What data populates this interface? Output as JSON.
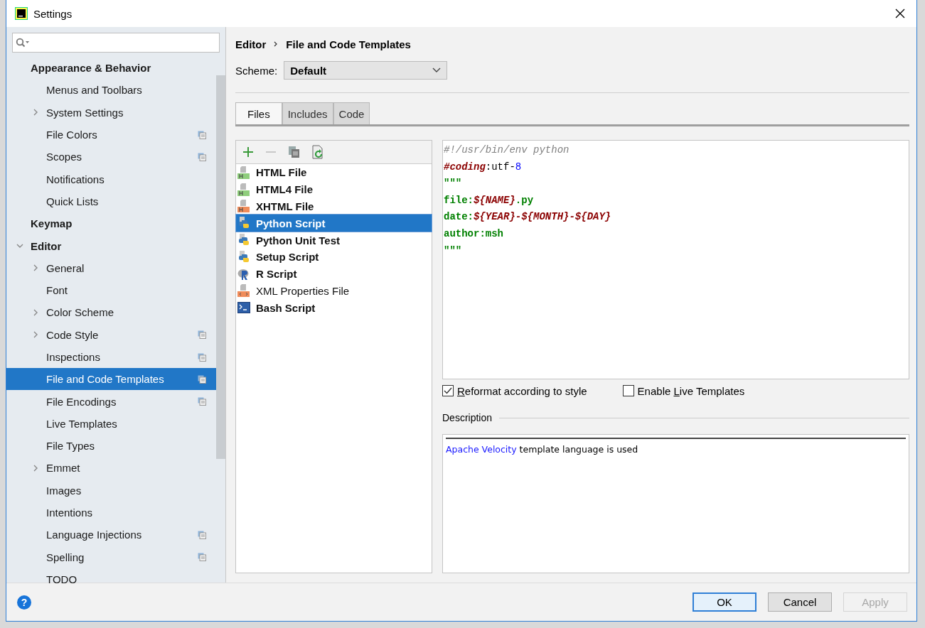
{
  "window": {
    "title": "Settings"
  },
  "sidebar": {
    "items": [
      {
        "label": "Appearance & Behavior",
        "selected": false,
        "children": [
          {
            "label": "Menus and Toolbars",
            "selected": false
          },
          {
            "label": "System Settings",
            "expanded": false,
            "selected": false
          },
          {
            "label": "File Colors",
            "project_level": true,
            "selected": false
          },
          {
            "label": "Scopes",
            "project_level": true,
            "selected": false
          },
          {
            "label": "Notifications",
            "selected": false
          },
          {
            "label": "Quick Lists",
            "selected": false
          }
        ]
      },
      {
        "label": "Keymap",
        "selected": false
      },
      {
        "label": "Editor",
        "expanded": true,
        "selected": false,
        "children": [
          {
            "label": "General",
            "expanded": false,
            "selected": false
          },
          {
            "label": "Font",
            "selected": false
          },
          {
            "label": "Color Scheme",
            "expanded": false,
            "selected": false
          },
          {
            "label": "Code Style",
            "expanded": false,
            "project_level": true,
            "selected": false
          },
          {
            "label": "Inspections",
            "project_level": true,
            "selected": false
          },
          {
            "label": "File and Code Templates",
            "project_level": true,
            "selected": true
          },
          {
            "label": "File Encodings",
            "project_level": true,
            "selected": false
          },
          {
            "label": "Live Templates",
            "selected": false
          },
          {
            "label": "File Types",
            "selected": false
          },
          {
            "label": "Emmet",
            "expanded": false,
            "selected": false
          },
          {
            "label": "Images",
            "selected": false
          },
          {
            "label": "Intentions",
            "selected": false
          },
          {
            "label": "Language Injections",
            "project_level": true,
            "selected": false
          },
          {
            "label": "Spelling",
            "project_level": true,
            "selected": false
          },
          {
            "label": "TODO",
            "selected": false
          }
        ]
      }
    ]
  },
  "breadcrumb": [
    "Editor",
    "File and Code Templates"
  ],
  "scheme": {
    "label": "Scheme:",
    "value": "Default"
  },
  "tabs": [
    {
      "label": "Files",
      "selected": true
    },
    {
      "label": "Includes",
      "selected": false
    },
    {
      "label": "Code",
      "selected": false
    }
  ],
  "toolbar": [
    {
      "kind": "add",
      "disabled": false
    },
    {
      "kind": "remove",
      "disabled": true
    },
    {
      "kind": "copy",
      "disabled": false
    },
    {
      "kind": "reset",
      "disabled": false
    }
  ],
  "templates": [
    {
      "label": "HTML File",
      "kind": "html",
      "bold": true,
      "selected": false
    },
    {
      "label": "HTML4 File",
      "kind": "html",
      "bold": true,
      "selected": false
    },
    {
      "label": "XHTML File",
      "kind": "xhtml",
      "bold": true,
      "selected": false
    },
    {
      "label": "Python Script",
      "kind": "python",
      "bold": true,
      "selected": true
    },
    {
      "label": "Python Unit Test",
      "kind": "python",
      "bold": true,
      "selected": false
    },
    {
      "label": "Setup Script",
      "kind": "python",
      "bold": true,
      "selected": false
    },
    {
      "label": "R Script",
      "kind": "r",
      "bold": true,
      "selected": false
    },
    {
      "label": "XML Properties File",
      "kind": "xml",
      "bold": false,
      "selected": false
    },
    {
      "label": "Bash Script",
      "kind": "bash",
      "bold": true,
      "selected": false
    }
  ],
  "code_lines": [
    [
      {
        "kind": "comment",
        "text": "#!/usr/bin/env python"
      }
    ],
    [
      {
        "kind": "directive",
        "text": "#coding"
      },
      {
        "kind": "plain",
        "text": ":utf-"
      },
      {
        "kind": "number",
        "text": "8"
      }
    ],
    [
      {
        "kind": "string",
        "text": "\"\"\""
      }
    ],
    [
      {
        "kind": "string",
        "text": "file:"
      },
      {
        "kind": "variable",
        "text": "${NAME}"
      },
      {
        "kind": "string",
        "text": ".py"
      }
    ],
    [
      {
        "kind": "string",
        "text": "date:"
      },
      {
        "kind": "variable",
        "text": "${YEAR}-${MONTH}-${DAY}"
      }
    ],
    [
      {
        "kind": "string",
        "text": "author:msh"
      }
    ],
    [
      {
        "kind": "string",
        "text": "\"\"\""
      }
    ]
  ],
  "options": [
    {
      "label": [
        {
          "text": "R",
          "mnemonic": true
        },
        {
          "text": "eformat according to style",
          "mnemonic": false
        }
      ],
      "checked": true
    },
    {
      "label": [
        {
          "text": "Enable ",
          "mnemonic": false
        },
        {
          "text": "L",
          "mnemonic": true
        },
        {
          "text": "ive Templates",
          "mnemonic": false
        }
      ],
      "checked": false
    }
  ],
  "description": {
    "title": "Description",
    "link": "Apache Velocity",
    "text": " template language is used"
  },
  "help": "?",
  "buttons": [
    {
      "label": "OK",
      "kind": "default",
      "disabled": false
    },
    {
      "label": "Cancel",
      "kind": "normal",
      "disabled": false
    },
    {
      "label": "Apply",
      "kind": "normal",
      "disabled": true
    }
  ]
}
